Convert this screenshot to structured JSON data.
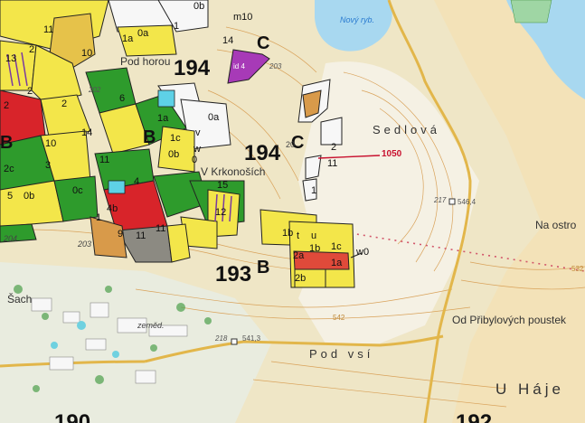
{
  "map": {
    "divisions": [
      {
        "number": "194",
        "letter": "C",
        "id": "div-194c-north"
      },
      {
        "number": "194",
        "letter": "C",
        "id": "div-194c-center"
      },
      {
        "number": "193",
        "letter": "B",
        "id": "div-193b"
      },
      {
        "letter": "B",
        "id": "div-b-west-1"
      },
      {
        "letter": "B",
        "id": "div-b-west-2"
      }
    ],
    "place_names": {
      "pod_horou": "Pod horou",
      "v_krkonosich": "V Krkonoších",
      "sedlova": "Sedlová",
      "na_ostrove": "Na ostro",
      "od_pribylovych": "Od Přibylových poustek",
      "pod_vsi": "Pod vsí",
      "u_haje": "U Háje",
      "sach": "Šach",
      "zemed": "zeměd."
    },
    "water": {
      "novy_ryb": "Nový ryb."
    },
    "stand_codes": [
      "m10",
      "14",
      "id 4",
      "203",
      "202",
      "0a",
      "14",
      "1a",
      "2",
      "1c",
      "0b",
      "w",
      "0",
      "11",
      "1a",
      "v",
      "1b",
      "t",
      "u",
      "2a",
      "1b",
      "1c",
      "w0",
      "2b",
      "1a",
      "20",
      "2",
      "11",
      "1",
      "4",
      "2",
      "5",
      "12",
      "11",
      "9",
      "4b",
      "2c",
      "3",
      "0c",
      "1",
      "0b",
      "10",
      "0a",
      "11",
      "2",
      "15",
      "6",
      "10",
      "11",
      "13",
      "204",
      "203",
      "1",
      "0b",
      "2"
    ],
    "heights": {
      "h1": "546,4",
      "h2": "541,3",
      "h3": "542",
      "h4": "532"
    },
    "points": {
      "p217": "217",
      "p218": "218"
    },
    "marker": {
      "label": "1050",
      "color": "#c8102e"
    },
    "bottom_numbers": [
      "190",
      "192"
    ],
    "colors": {
      "background": "#efe6c6",
      "forest_yellow": "#f3e64a",
      "forest_green": "#2e9b2c",
      "red": "#d8242a",
      "magenta": "#a73ab7",
      "water": "#a8d8f0",
      "road": "#e2b64a",
      "contour": "#d9a25a"
    }
  }
}
